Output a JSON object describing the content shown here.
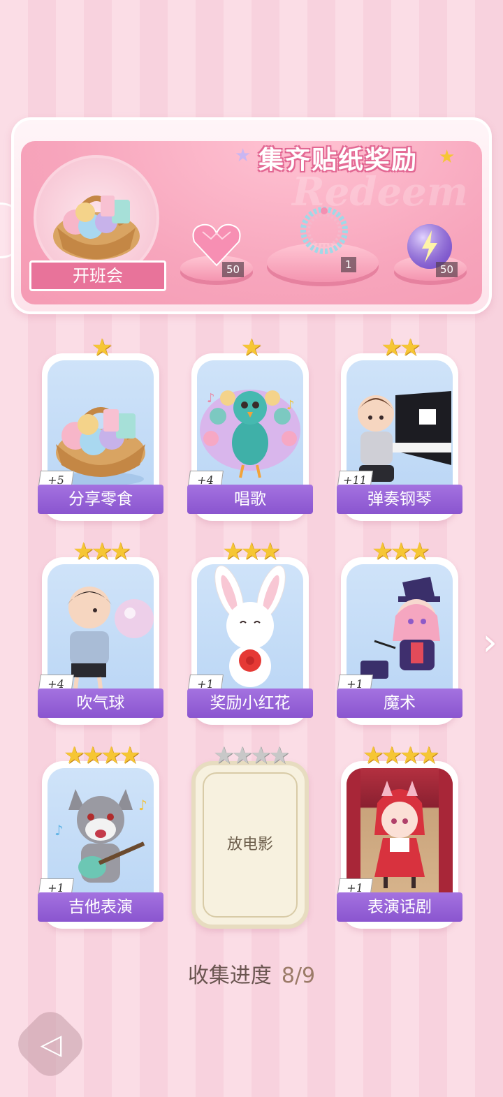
{
  "banner": {
    "title": "集齐贴纸奖励",
    "watermark": "Redeem",
    "event_label": "开班会",
    "rewards": [
      {
        "icon": "pink-heart-gem-icon",
        "count": "50"
      },
      {
        "icon": "bracelet-icon",
        "count": "1"
      },
      {
        "icon": "purple-lightning-orb-icon",
        "count": "50"
      }
    ]
  },
  "cards": [
    {
      "name": "分享零食",
      "stars": 1,
      "count": "+5",
      "locked": false,
      "art": "snack-basket"
    },
    {
      "name": "唱歌",
      "stars": 1,
      "count": "+4",
      "locked": false,
      "art": "peacock-singing"
    },
    {
      "name": "弹奏钢琴",
      "stars": 2,
      "count": "+11",
      "locked": false,
      "art": "boy-piano"
    },
    {
      "name": "吹气球",
      "stars": 3,
      "count": "+4",
      "locked": false,
      "art": "boy-bubble"
    },
    {
      "name": "奖励小红花",
      "stars": 3,
      "count": "+1",
      "locked": false,
      "art": "bunny-flower"
    },
    {
      "name": "魔术",
      "stars": 3,
      "count": "+1",
      "locked": false,
      "art": "magician-girl"
    },
    {
      "name": "吉他表演",
      "stars": 4,
      "count": "+1",
      "locked": false,
      "art": "wolf-guitar"
    },
    {
      "name": "放电影",
      "stars": 4,
      "count": "",
      "locked": true,
      "art": "locked"
    },
    {
      "name": "表演话剧",
      "stars": 4,
      "count": "+1",
      "locked": false,
      "art": "cat-girl-stage"
    }
  ],
  "progress": {
    "label": "收集进度",
    "value": "8/9"
  },
  "colors": {
    "accent_purple": "#8a55cf",
    "accent_pink": "#e8739a",
    "star_gold": "#f6c634"
  }
}
